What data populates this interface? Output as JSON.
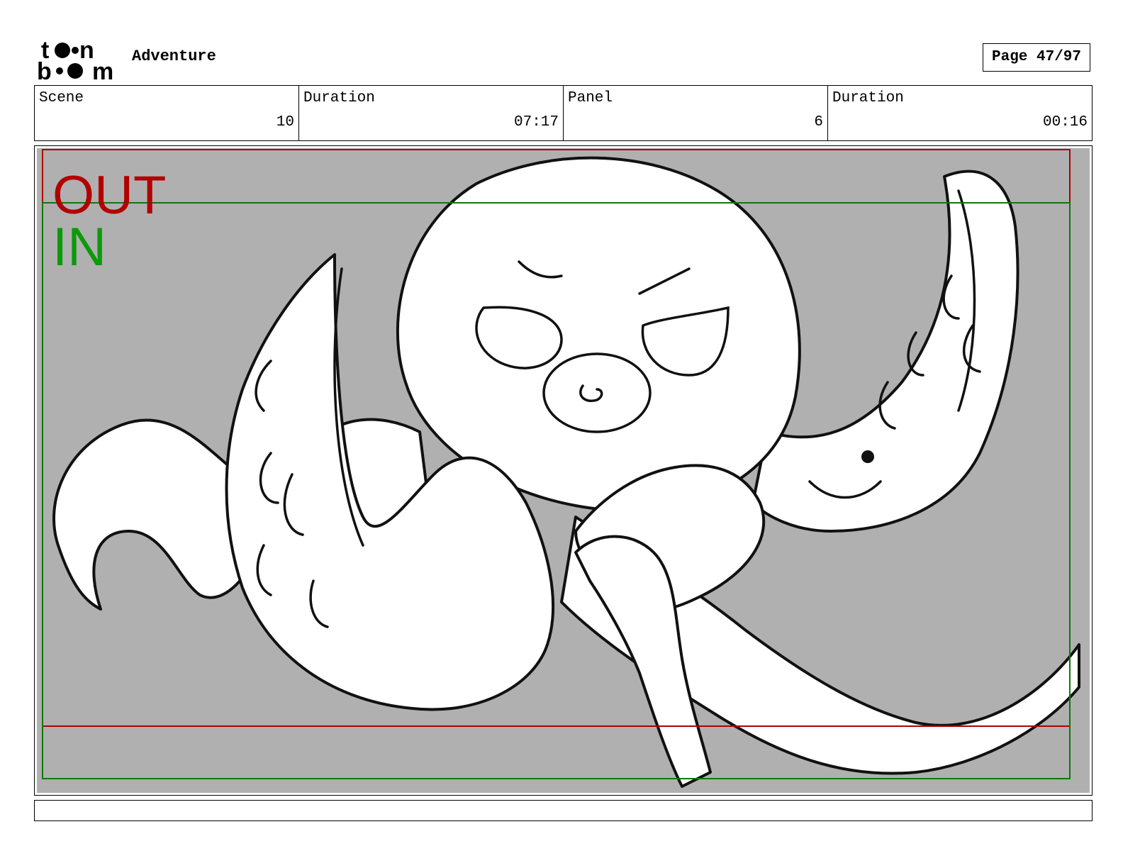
{
  "header": {
    "logo_text": "toon boom",
    "project_title": "Adventure",
    "page_label": "Page 47/97"
  },
  "info": {
    "scene_label": "Scene",
    "scene_value": "10",
    "scene_duration_label": "Duration",
    "scene_duration_value": "07:17",
    "panel_label": "Panel",
    "panel_value": "6",
    "panel_duration_label": "Duration",
    "panel_duration_value": "00:16"
  },
  "panel": {
    "out_label": "OUT",
    "in_label": "IN",
    "out_color": "#b00000",
    "in_color": "#0a9a0a",
    "background_color": "#b0b0b0",
    "subject": "octopus-sketch"
  },
  "notes": {
    "text": ""
  }
}
